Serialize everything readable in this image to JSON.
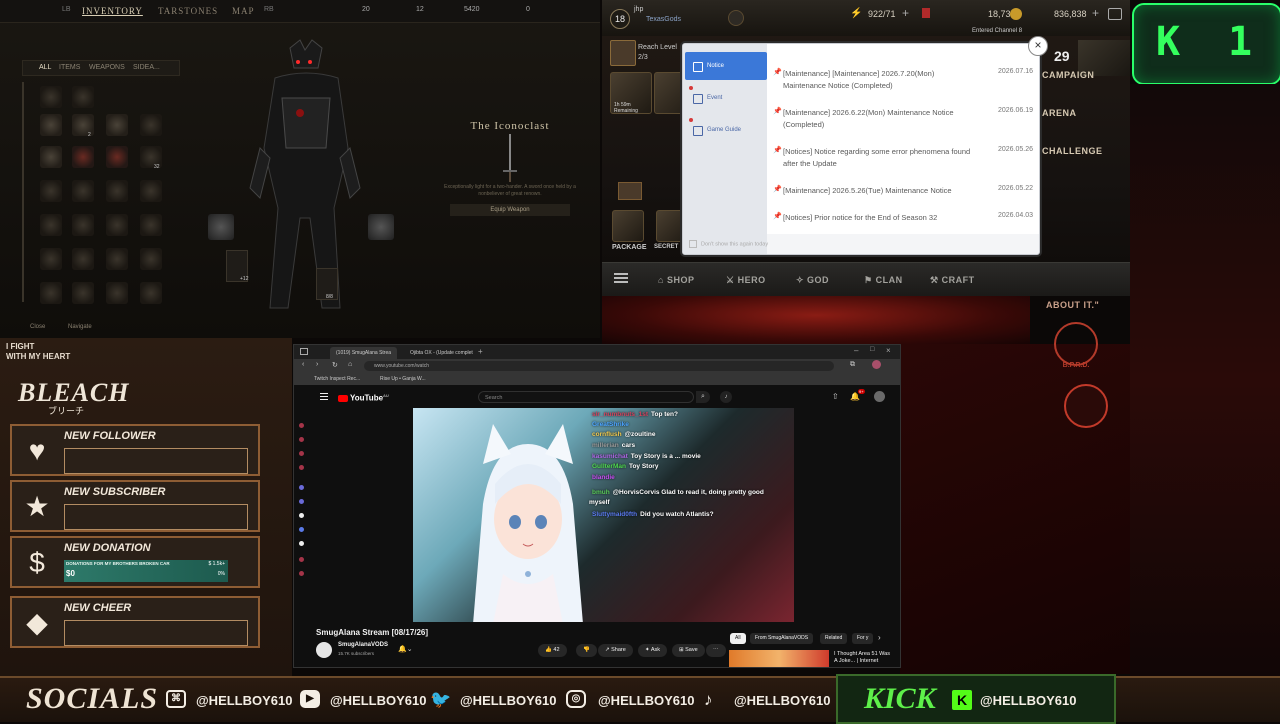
{
  "inventory": {
    "tabs": [
      "INVENTORY",
      "TARSTONES",
      "MAP"
    ],
    "resources": [
      "20",
      "12",
      "5420",
      "0"
    ],
    "filters": [
      "ALL",
      "ITEMS",
      "WEAPONS",
      "SIDEA..."
    ],
    "item_name": "The Iconoclast",
    "item_desc": "Exceptionally light for a two-hander. A sword once held by a nonbeliever of great renown.",
    "equip_label": "Equip Weapon",
    "slot_counts": [
      "+12",
      "8/8",
      "32",
      "2"
    ],
    "footer_close": "Close",
    "footer_navigate": "Navigate"
  },
  "mobile_game": {
    "level": "18",
    "player_name": "jhp",
    "guild": "TexasGods",
    "energy": "922/71",
    "gold": "18,735",
    "gems": "836,838",
    "reach_level": "Reach Level",
    "reach_progress": "2/3",
    "entered_channel": "Entered Channel 8",
    "side_count": "29",
    "side_menu": [
      "CAMPAIGN",
      "ARENA",
      "CHALLENGE"
    ],
    "remaining": "1h 59m\nRemaining",
    "left_labels": [
      "PACKAGE",
      "SECRET S..."
    ],
    "bottom_nav": [
      "SHOP",
      "HERO",
      "GOD",
      "CLAN",
      "CRAFT"
    ]
  },
  "notice_popup": {
    "nav": [
      {
        "label": "Notice",
        "active": true
      },
      {
        "label": "Event",
        "active": false
      },
      {
        "label": "Game Guide",
        "active": false
      }
    ],
    "items": [
      {
        "title": "[Maintenance] [Maintenance] 2026.7.20(Mon) Maintenance Notice (Completed)",
        "date": "2026.07.16"
      },
      {
        "title": "[Maintenance] 2026.6.22(Mon) Maintenance Notice (Completed)",
        "date": "2026.06.19"
      },
      {
        "title": "[Notices] Notice regarding some error phenomena found after the Update",
        "date": "2026.05.26"
      },
      {
        "title": "[Maintenance] 2026.5.26(Tue) Maintenance Notice",
        "date": "2026.05.22"
      },
      {
        "title": "[Notices] Prior notice for the End of Season 32",
        "date": "2026.04.03"
      }
    ],
    "dont_show": "Don't show this again today",
    "close_symbol": "×"
  },
  "kick_badge": {
    "k": "K",
    "num": "1"
  },
  "hellboy": {
    "about": "ABOUT IT.\"",
    "bprd": "B.P.R.D."
  },
  "alerts_panel": {
    "tagline_line1": "I FIGHT",
    "tagline_line2": "WITH MY HEART",
    "logo": "BLEACH",
    "logo_sub": "ブリーチ",
    "alerts": [
      {
        "label": "NEW FOLLOWER",
        "icon": "heart-icon"
      },
      {
        "label": "NEW SUBSCRIBER",
        "icon": "star-icon"
      },
      {
        "label": "NEW DONATION",
        "icon": "dollar-icon",
        "goal_title": "DONATIONS FOR MY BROTHERS BROKEN CAR",
        "goal_value": "$0",
        "goal_percent": "0%",
        "goal_max": "$ 1.5k+"
      },
      {
        "label": "NEW CHEER",
        "icon": "diamond-icon"
      }
    ]
  },
  "browser": {
    "tabs": [
      "(1019) SmugAlana Strea",
      "Ojibta OX - (Update complet"
    ],
    "url": "www.youtube.com/watch",
    "bookmarks": [
      "Twitch Inspect Rec...",
      "Rise Up • Ganja W..."
    ],
    "yt_logo": "YouTube",
    "yt_region": "AU",
    "search_placeholder": "Search",
    "notif_count": "9+",
    "video_title": "SmugAlana Stream [08/17/26]",
    "channel": "SmugAlanaVODS",
    "subscribers": "15.7K subscribers",
    "likes": "42",
    "buttons": [
      "Share",
      "Ask",
      "Save"
    ],
    "chips": [
      "All",
      "From SmugAlanaVODS",
      "Related",
      "For y"
    ],
    "related_title": "I Thought Area 51 Was A Joke... | Internet",
    "chat": [
      {
        "user": "sir_numbnuts_1st",
        "msg": "Top ten?"
      },
      {
        "user": "GreatShrike",
        "msg": ""
      },
      {
        "user": "cornflush",
        "msg": "@zoultine"
      },
      {
        "user": "millerian",
        "msg": "cars"
      },
      {
        "user": "kasumichat",
        "msg": "Toy Story is a ... movie"
      },
      {
        "user": "GullterMan",
        "msg": "Toy Story"
      },
      {
        "user": "blandie",
        "msg": ""
      },
      {
        "user": "bmuh",
        "msg": "@HorvisCorvis Glad to read it, doing pretty good"
      },
      {
        "user": "",
        "msg": "myself"
      },
      {
        "user": "Sluttymaid0fth",
        "msg": "Did you watch Atlantis?"
      }
    ]
  },
  "socials": {
    "title": "SOCIALS",
    "handles": [
      {
        "icon": "twitch-icon",
        "handle": "@HELLBOY610"
      },
      {
        "icon": "youtube-icon",
        "handle": "@HELLBOY610"
      },
      {
        "icon": "twitter-icon",
        "handle": "@HELLBOY610"
      },
      {
        "icon": "instagram-icon",
        "handle": "@HELLBOY610"
      },
      {
        "icon": "tiktok-icon",
        "handle": "@HELLBOY610"
      }
    ],
    "kick_title": "KICK",
    "kick_handle": "@HELLBOY610"
  },
  "colors": {
    "kick_green": "#53fc18",
    "notice_blue": "#3b78d8",
    "youtube_red": "#ff0000",
    "alert_border": "#8e5d34"
  }
}
